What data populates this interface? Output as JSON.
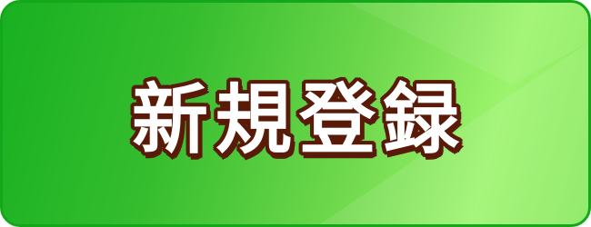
{
  "button": {
    "label": "新規登録"
  },
  "colors": {
    "border": "#13a81c",
    "gradient_start": "#18b021",
    "gradient_end": "#9df46d",
    "text": "#ffffff",
    "text_outline": "#5a1a08"
  }
}
